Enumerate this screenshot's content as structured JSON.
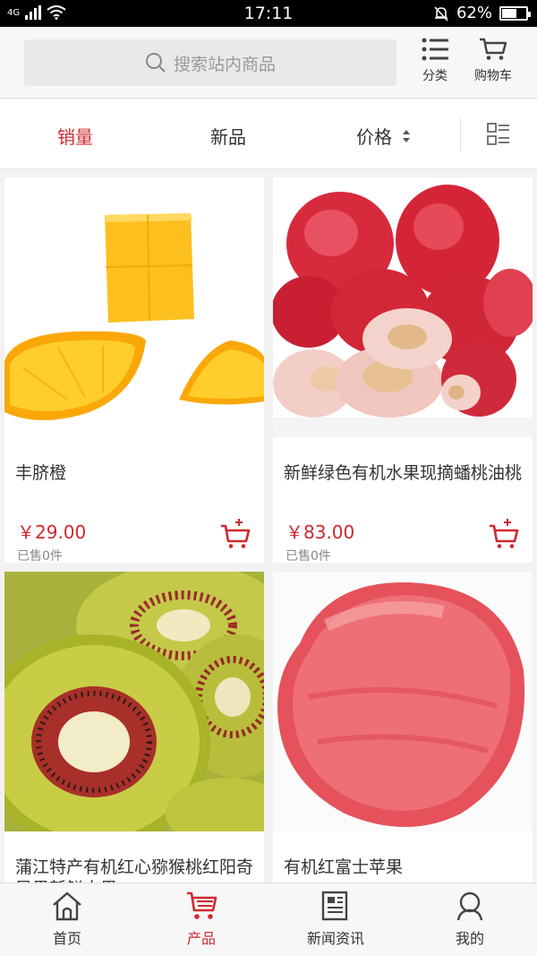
{
  "status_bar": {
    "network": "4G",
    "time": "17:11",
    "battery": "62%",
    "battery_level": 0.62
  },
  "header": {
    "search_placeholder": "搜索站内商品",
    "category_label": "分类",
    "cart_label": "购物车"
  },
  "sort_bar": {
    "sales": "销量",
    "new": "新品",
    "price": "价格"
  },
  "products": [
    {
      "name": "丰脐橙",
      "price": "￥29.00",
      "sold": "已售0件"
    },
    {
      "name": "新鲜绿色有机水果现摘蟠桃油桃",
      "price": "￥83.00",
      "sold": "已售0件"
    },
    {
      "name": "蒲江特产有机红心猕猴桃红阳奇异果新鲜水果",
      "price": "",
      "sold": ""
    },
    {
      "name": "有机红富士苹果",
      "price": "",
      "sold": ""
    }
  ],
  "tab_bar": {
    "home": "首页",
    "products": "产品",
    "news": "新闻资讯",
    "mine": "我的"
  },
  "colors": {
    "accent": "#d0282e",
    "background": "#f2f2f2"
  }
}
